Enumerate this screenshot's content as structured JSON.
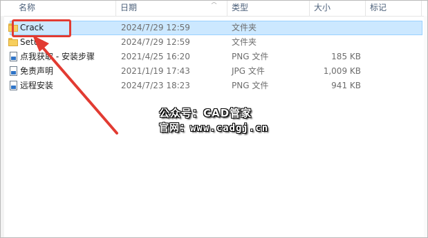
{
  "columns": {
    "name": "名称",
    "date": "日期",
    "type": "类型",
    "size": "大小",
    "tags": "标记"
  },
  "files": [
    {
      "name": "Crack",
      "date": "2024/7/29 12:59",
      "type": "文件夹",
      "size": "",
      "icon": "folder-icon",
      "selected": true
    },
    {
      "name": "Setup",
      "date": "2024/7/29 12:59",
      "type": "文件夹",
      "size": "",
      "icon": "folder-icon",
      "selected": false
    },
    {
      "name": "点我获取 - 安装步骤",
      "date": "2021/4/25 16:20",
      "type": "PNG 文件",
      "size": "185 KB",
      "icon": "image-file-icon",
      "selected": false
    },
    {
      "name": "免责声明",
      "date": "2021/1/19 17:43",
      "type": "JPG 文件",
      "size": "1,009 KB",
      "icon": "image-file-icon",
      "selected": false
    },
    {
      "name": "远程安装",
      "date": "2024/7/23 18:23",
      "type": "PNG 文件",
      "size": "941 KB",
      "icon": "image-file-icon",
      "selected": false
    }
  ],
  "watermark": {
    "line1": "公众号：CAD管家",
    "line2": "官网：www.cadgj.cn"
  },
  "colors": {
    "selection": "#cce8ff",
    "annotation": "#e23b32"
  }
}
